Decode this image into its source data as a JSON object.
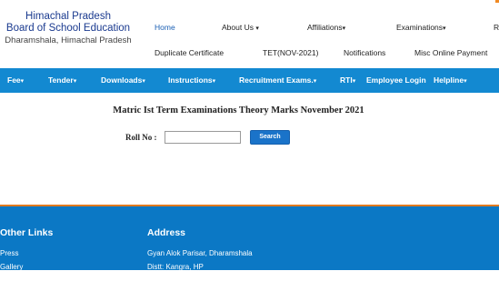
{
  "header": {
    "logo_line1": "Himachal Pradesh",
    "logo_line2": "Board of School Education",
    "logo_line3": "Dharamshala, Himachal Pradesh",
    "top_nav_row1": [
      "Home",
      "About Us",
      "Affiliations",
      "Examinations",
      "R"
    ],
    "top_nav_row2": [
      "Duplicate Certificate",
      "TET(NOV-2021)",
      "Notifications",
      "Misc Online Payment"
    ],
    "dropdown_caret": "▾"
  },
  "navbar": {
    "items": [
      "Fee",
      "Tender",
      "Downloads",
      "Instructions",
      "Recruitment Exams.",
      "RTI",
      "Employee Login",
      "Helpline"
    ]
  },
  "main": {
    "title": "Matric Ist Term Examinations Theory Marks November 2021",
    "roll_label": "Roll No :",
    "roll_value": "",
    "search_label": "Search"
  },
  "footer": {
    "other_links_heading": "Other Links",
    "other_links": [
      "Press",
      "Gallery"
    ],
    "address_heading": "Address",
    "address_lines": [
      "Gyan Alok Parisar, Dharamshala",
      "Distt: Kangra, HP"
    ]
  },
  "colors": {
    "brand_blue": "#1a3a8f",
    "navbar_bg": "#1389d1",
    "footer_bg": "#0b78c5",
    "accent_orange": "#e07a1f"
  }
}
